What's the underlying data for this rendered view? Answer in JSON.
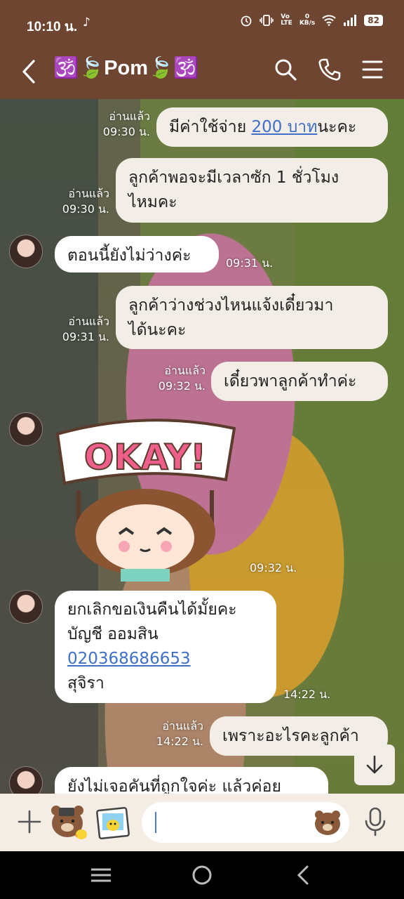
{
  "status": {
    "time": "10:10 น.",
    "net_line1": "0",
    "net_line2": "KB/s",
    "battery": "82",
    "tiktok_icon": "tiktok-icon"
  },
  "header": {
    "title": "🕉️🍃Pom🍃🕉️",
    "icons": [
      "back-icon",
      "search-icon",
      "phone-icon",
      "menu-icon"
    ]
  },
  "messages": [
    {
      "dir": "out",
      "read": "อ่านแล้ว",
      "time": "09:30 น.",
      "text_before": "มีค่าใช้จ่าย ",
      "link": "200 บาท",
      "text_after": "นะคะ"
    },
    {
      "dir": "out",
      "read": "อ่านแล้ว",
      "time": "09:30 น.",
      "line1": "ลูกค้าพอจะมีเวลาซัก 1 ชั่วโมง",
      "line2": "ไหมคะ"
    },
    {
      "dir": "in",
      "time": "09:31 น.",
      "text": "ตอนนี้ยังไม่ว่างค่ะ"
    },
    {
      "dir": "out",
      "read": "อ่านแล้ว",
      "time": "09:31 น.",
      "line1": "ลูกค้าว่างช่วงไหนแจ้งเดี๋ยวมา",
      "line2": "ได้นะคะ"
    },
    {
      "dir": "out",
      "read": "อ่านแล้ว",
      "time": "09:32 น.",
      "text": "เดี๋ยวพาลูกค้าทำค่ะ"
    },
    {
      "dir": "in",
      "type": "sticker",
      "sticker_text": "OKAY!",
      "time": "09:32 น."
    },
    {
      "dir": "in",
      "time": "14:22 น.",
      "line1": "ยกเลิกขอเงินคืนได้มั้ยคะ",
      "line2": "บัญชี ออมสิน",
      "link": "020368686653",
      "line4": "สุจิรา"
    },
    {
      "dir": "out",
      "read": "อ่านแล้ว",
      "time": "14:22 น.",
      "text": "เพราะอะไรคะลูกค้า"
    },
    {
      "dir": "in",
      "text": "ยังไม่เจอคันที่ถูกใจค่ะ แล้วค่อย"
    }
  ],
  "input": {
    "placeholder": "",
    "icons": [
      "plus-icon",
      "sticker-icon",
      "photo-icon",
      "emoji-icon",
      "mic-icon"
    ]
  },
  "colors": {
    "header_bg": "#6e4530",
    "bubble_out": "#f2ede6",
    "bubble_in": "#ffffff",
    "link": "#3f6fc9",
    "input_bar": "#f3ede4"
  }
}
